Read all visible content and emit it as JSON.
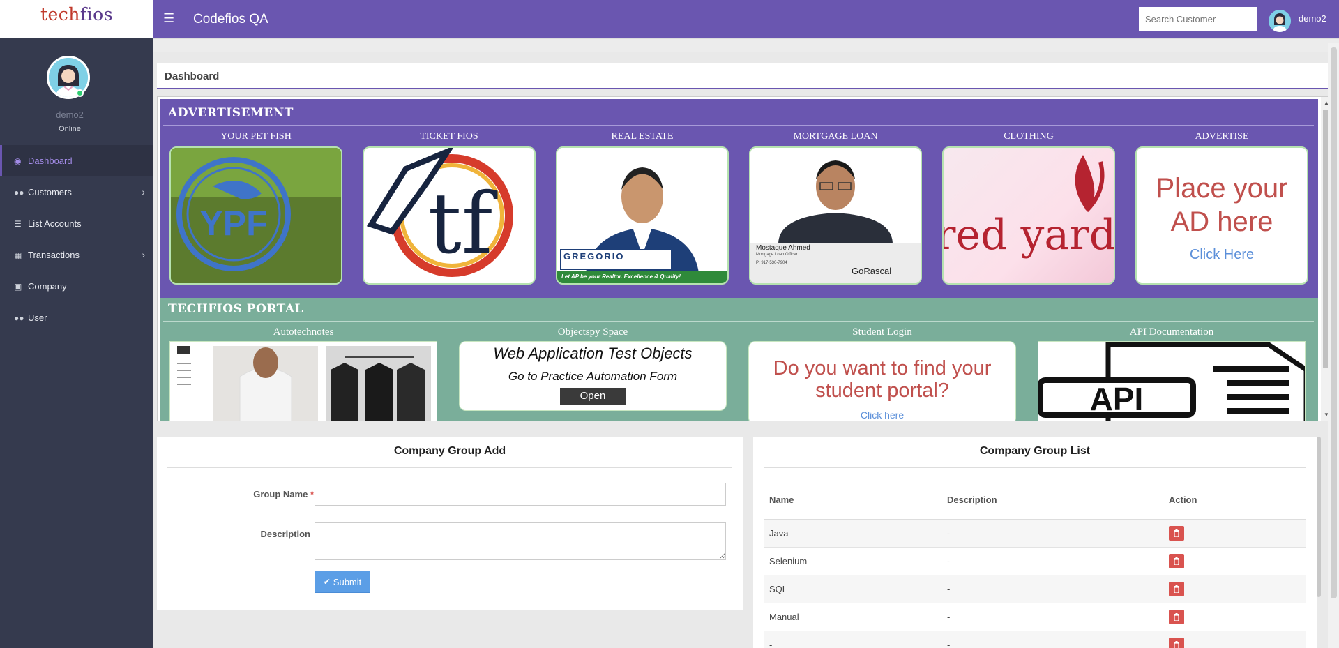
{
  "brand": {
    "logo_part1": "tech",
    "logo_part2": "fios"
  },
  "topbar": {
    "app_title": "Codefios QA",
    "search_placeholder": "Search Customer",
    "user_name": "demo2"
  },
  "sidebar": {
    "user_name": "demo2",
    "status": "Online",
    "items": [
      {
        "label": "Dashboard",
        "icon": "dashboard-icon"
      },
      {
        "label": "Customers",
        "icon": "users-icon"
      },
      {
        "label": "List Accounts",
        "icon": "list-icon"
      },
      {
        "label": "Transactions",
        "icon": "transactions-icon"
      },
      {
        "label": "Company",
        "icon": "lock-icon"
      },
      {
        "label": "User",
        "icon": "users-icon"
      }
    ]
  },
  "breadcrumb": "Dashboard",
  "advertisement": {
    "title": "ADVERTISEMENT",
    "cards": [
      {
        "caption": "YOUR PET FISH",
        "logo_text": "YPF"
      },
      {
        "caption": "TICKET FIOS",
        "logo_text": "tf"
      },
      {
        "caption": "REAL ESTATE",
        "brand_text": "GREGORIO",
        "tagline": "Let AP be your Realtor. Excellence & Quality!"
      },
      {
        "caption": "MORTGAGE LOAN",
        "name_text": "Mostaque Ahmed",
        "role_text": "Mortgage Loan Officer",
        "phone_text": "P: 917-530-7904",
        "brand_text": "GoRascal"
      },
      {
        "caption": "CLOTHING",
        "logo_text": "red yard"
      },
      {
        "caption": "ADVERTISE",
        "line1": "Place your",
        "line2": "AD here",
        "link": "Click Here"
      }
    ]
  },
  "portal": {
    "title": "TECHFIOS PORTAL",
    "cards": [
      {
        "caption": "Autotechnotes"
      },
      {
        "caption": "Objectspy Space",
        "heading": "Web Application Test Objects",
        "sub": "Go to Practice Automation Form",
        "button": "Open"
      },
      {
        "caption": "Student Login",
        "line1": "Do you want to find your",
        "line2": "student portal?",
        "link": "Click here"
      },
      {
        "caption": "API Documentation",
        "logo_text": "API"
      }
    ]
  },
  "group_add": {
    "title": "Company Group Add",
    "name_label": "Group Name",
    "required_mark": "*",
    "desc_label": "Description",
    "submit": "Submit"
  },
  "group_list": {
    "title": "Company Group List",
    "columns": [
      "Name",
      "Description",
      "Action"
    ],
    "rows": [
      {
        "name": "Java",
        "description": "-"
      },
      {
        "name": "Selenium",
        "description": "-"
      },
      {
        "name": "SQL",
        "description": "-"
      },
      {
        "name": "Manual",
        "description": "-"
      },
      {
        "name": "-",
        "description": "-"
      }
    ]
  },
  "colors": {
    "primary": "#6a56b0",
    "sidebar": "#353a4e",
    "portal": "#7aae9a",
    "danger": "#d9534f",
    "submit": "#5b9ee6"
  }
}
